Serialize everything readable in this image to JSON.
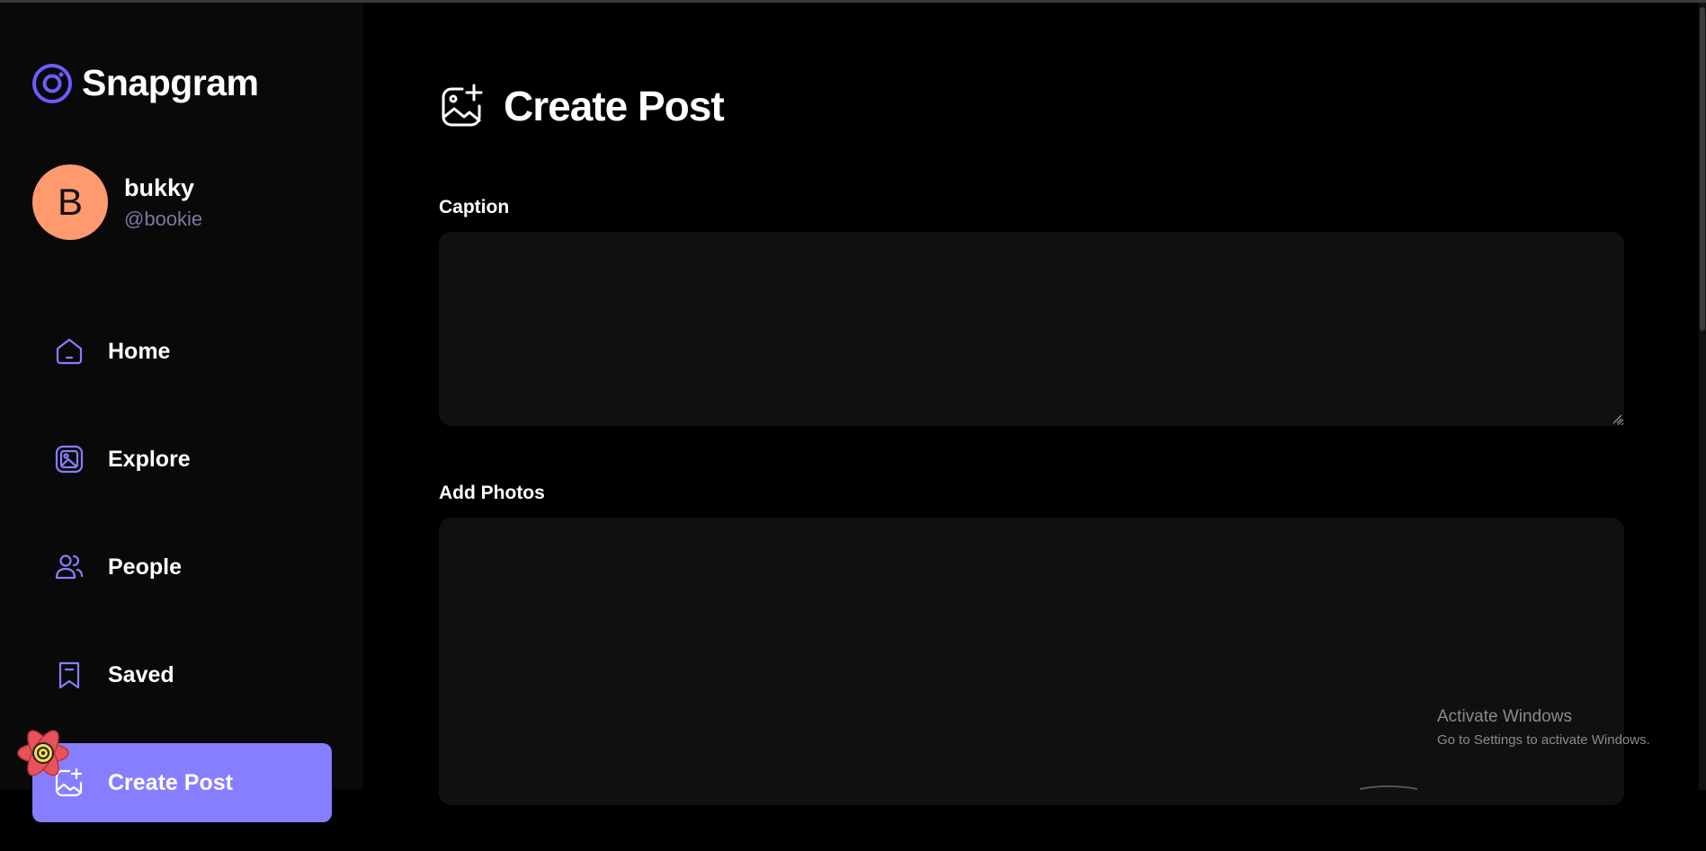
{
  "app": {
    "name": "Snapgram",
    "icon": "snapgram-logo-icon",
    "accent": "#877eff"
  },
  "user": {
    "initial": "B",
    "name": "bukky",
    "handle": "@bookie",
    "avatar_color": "#ff9a6e"
  },
  "nav": {
    "items": [
      {
        "label": "Home",
        "icon": "home-icon",
        "active": false
      },
      {
        "label": "Explore",
        "icon": "explore-icon",
        "active": false
      },
      {
        "label": "People",
        "icon": "people-icon",
        "active": false
      },
      {
        "label": "Saved",
        "icon": "bookmark-icon",
        "active": false
      },
      {
        "label": "Create Post",
        "icon": "gallery-add-icon",
        "active": true
      }
    ]
  },
  "page": {
    "title": "Create Post",
    "icon": "gallery-add-icon"
  },
  "form": {
    "caption_label": "Caption",
    "caption_value": "",
    "photos_label": "Add Photos"
  },
  "watermark": {
    "title": "Activate Windows",
    "subtitle": "Go to Settings to activate Windows."
  }
}
